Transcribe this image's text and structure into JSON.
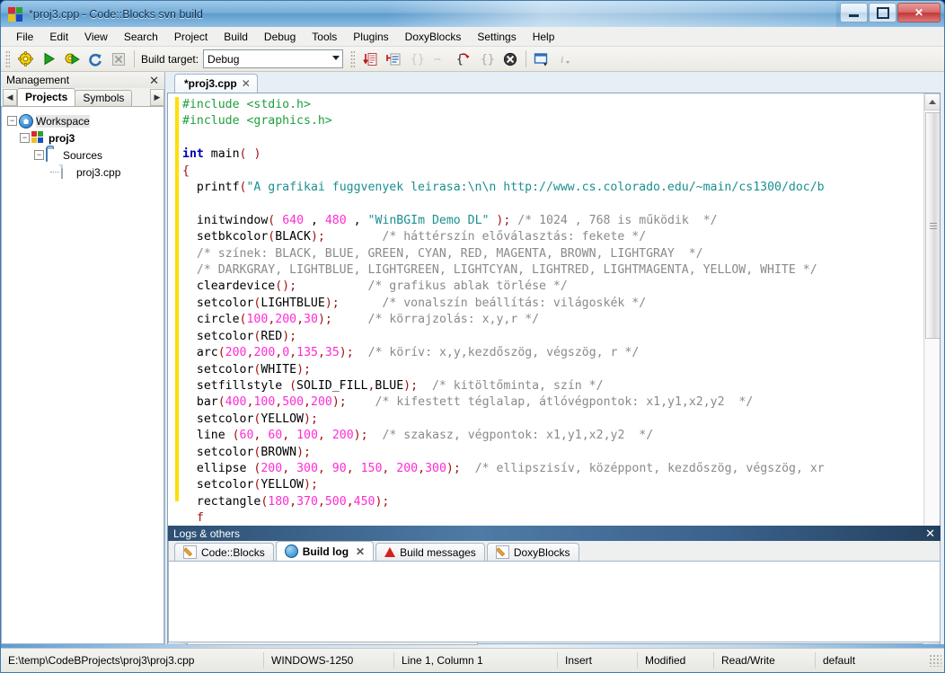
{
  "window": {
    "title": "*proj3.cpp - Code::Blocks svn build",
    "logo_icon": "codeblocks-logo-icon",
    "minimize_label": "minimize-icon",
    "maximize_label": "maximize-icon",
    "close_label": "✕"
  },
  "menubar": {
    "items": [
      {
        "label": "File"
      },
      {
        "label": "Edit"
      },
      {
        "label": "View"
      },
      {
        "label": "Search"
      },
      {
        "label": "Project"
      },
      {
        "label": "Build"
      },
      {
        "label": "Debug"
      },
      {
        "label": "Tools"
      },
      {
        "label": "Plugins"
      },
      {
        "label": "DoxyBlocks"
      },
      {
        "label": "Settings"
      },
      {
        "label": "Help"
      }
    ]
  },
  "toolbar": {
    "build_target_label": "Build target:",
    "build_target_value": "Debug",
    "buttons": [
      {
        "name": "build-icon",
        "glyph": "⚙"
      },
      {
        "name": "run-icon",
        "glyph": "▶"
      },
      {
        "name": "build-and-run-icon",
        "glyph": "⚙▶"
      },
      {
        "name": "rebuild-icon",
        "glyph": "♻"
      },
      {
        "name": "abort-icon",
        "glyph": "✕"
      }
    ],
    "doxy_buttons": [
      {
        "name": "doxyblocks-extract-icon",
        "glyph": "↓"
      },
      {
        "name": "doxyblocks-comment-icon",
        "glyph": "✎"
      },
      {
        "name": "doxyblocks-block-comment-icon",
        "glyph": "{}"
      },
      {
        "name": "doxyblocks-line-comment-icon",
        "glyph": "⋯"
      },
      {
        "name": "doxyblocks-run-icon",
        "glyph": "{↵}"
      },
      {
        "name": "doxyblocks-config-icon",
        "glyph": "{}"
      },
      {
        "name": "doxyblocks-stop-icon",
        "glyph": "✕"
      },
      {
        "name": "doxyblocks-wizard-icon",
        "glyph": "▢"
      },
      {
        "name": "doxyblocks-info-icon",
        "glyph": "i"
      }
    ]
  },
  "management": {
    "title": "Management",
    "close_glyph": "✕",
    "prev_glyph": "◀",
    "next_glyph": "▶",
    "tabs": [
      {
        "label": "Projects",
        "active": true
      },
      {
        "label": "Symbols",
        "active": false
      }
    ],
    "tree": [
      {
        "label": "Workspace",
        "icon": "workspace-icon",
        "depth": 0,
        "expander": "−",
        "bold": false,
        "selected": true
      },
      {
        "label": "proj3",
        "icon": "project-icon",
        "depth": 1,
        "expander": "−",
        "bold": true,
        "selected": false
      },
      {
        "label": "Sources",
        "icon": "folder-icon",
        "depth": 2,
        "expander": "−",
        "bold": false,
        "selected": false
      },
      {
        "label": "proj3.cpp",
        "icon": "file-icon",
        "depth": 3,
        "expander": "",
        "bold": false,
        "selected": false
      }
    ]
  },
  "editor": {
    "tab_label": "*proj3.cpp",
    "tab_close_glyph": "✕",
    "scroll_up_glyph": "▲",
    "scroll_down_glyph": "▼",
    "scroll_left_glyph": "◀",
    "scroll_right_glyph": "▶",
    "code_lines": [
      [
        [
          "#include ",
          "pre"
        ],
        [
          "<stdio.h>",
          "pre"
        ]
      ],
      [
        [
          "#include ",
          "pre"
        ],
        [
          "<graphics.h>",
          "pre"
        ]
      ],
      [],
      [
        [
          "int",
          "kw"
        ],
        [
          " main",
          "id"
        ],
        [
          "(",
          "op"
        ],
        [
          " ",
          "id"
        ],
        [
          ")",
          "op"
        ]
      ],
      [
        [
          "{",
          "op"
        ]
      ],
      [
        [
          "  printf",
          "id"
        ],
        [
          "(",
          "op"
        ],
        [
          "\"A grafikai fuggvenyek leirasa:\\n\\n http://www.cs.colorado.edu/~main/cs1300/doc/b",
          "str"
        ]
      ],
      [],
      [
        [
          "  initwindow",
          "id"
        ],
        [
          "(",
          "op"
        ],
        [
          " ",
          "id"
        ],
        [
          "640",
          "num"
        ],
        [
          " , ",
          "id"
        ],
        [
          "480",
          "num"
        ],
        [
          " , ",
          "id"
        ],
        [
          "\"WinBGIm Demo DL\"",
          "str"
        ],
        [
          " )",
          "op"
        ],
        [
          ";",
          "op"
        ],
        [
          " ",
          "id"
        ],
        [
          "/* 1024 , 768 is működik  */",
          "cmt"
        ]
      ],
      [
        [
          "  setbkcolor",
          "id"
        ],
        [
          "(",
          "op"
        ],
        [
          "BLACK",
          "id"
        ],
        [
          ")",
          "op"
        ],
        [
          ";",
          "op"
        ],
        [
          "        ",
          "id"
        ],
        [
          "/* háttérszín előválasztás: fekete */",
          "cmt"
        ]
      ],
      [
        [
          "  ",
          "id"
        ],
        [
          "/* színek: BLACK, BLUE, GREEN, CYAN, RED, MAGENTA, BROWN, LIGHTGRAY  */",
          "cmt"
        ]
      ],
      [
        [
          "  ",
          "id"
        ],
        [
          "/* DARKGRAY, LIGHTBLUE, LIGHTGREEN, LIGHTCYAN, LIGHTRED, LIGHTMAGENTA, YELLOW, WHITE */",
          "cmt"
        ]
      ],
      [
        [
          "  cleardevice",
          "id"
        ],
        [
          "(",
          "op"
        ],
        [
          ")",
          "op"
        ],
        [
          ";",
          "op"
        ],
        [
          "          ",
          "id"
        ],
        [
          "/* grafikus ablak törlése */",
          "cmt"
        ]
      ],
      [
        [
          "  setcolor",
          "id"
        ],
        [
          "(",
          "op"
        ],
        [
          "LIGHTBLUE",
          "id"
        ],
        [
          ")",
          "op"
        ],
        [
          ";",
          "op"
        ],
        [
          "      ",
          "id"
        ],
        [
          "/* vonalszín beállítás: világoskék */",
          "cmt"
        ]
      ],
      [
        [
          "  circle",
          "id"
        ],
        [
          "(",
          "op"
        ],
        [
          "100",
          "num"
        ],
        [
          ",",
          "op"
        ],
        [
          "200",
          "num"
        ],
        [
          ",",
          "op"
        ],
        [
          "30",
          "num"
        ],
        [
          ")",
          "op"
        ],
        [
          ";",
          "op"
        ],
        [
          "     ",
          "id"
        ],
        [
          "/* körrajzolás: x,y,r */",
          "cmt"
        ]
      ],
      [
        [
          "  setcolor",
          "id"
        ],
        [
          "(",
          "op"
        ],
        [
          "RED",
          "id"
        ],
        [
          ")",
          "op"
        ],
        [
          ";",
          "op"
        ]
      ],
      [
        [
          "  arc",
          "id"
        ],
        [
          "(",
          "op"
        ],
        [
          "200",
          "num"
        ],
        [
          ",",
          "op"
        ],
        [
          "200",
          "num"
        ],
        [
          ",",
          "op"
        ],
        [
          "0",
          "num"
        ],
        [
          ",",
          "op"
        ],
        [
          "135",
          "num"
        ],
        [
          ",",
          "op"
        ],
        [
          "35",
          "num"
        ],
        [
          ")",
          "op"
        ],
        [
          ";",
          "op"
        ],
        [
          "  ",
          "id"
        ],
        [
          "/* körív: x,y,kezdőszög, végszög, r */",
          "cmt"
        ]
      ],
      [
        [
          "  setcolor",
          "id"
        ],
        [
          "(",
          "op"
        ],
        [
          "WHITE",
          "id"
        ],
        [
          ")",
          "op"
        ],
        [
          ";",
          "op"
        ]
      ],
      [
        [
          "  setfillstyle ",
          "id"
        ],
        [
          "(",
          "op"
        ],
        [
          "SOLID_FILL",
          "id"
        ],
        [
          ",",
          "op"
        ],
        [
          "BLUE",
          "id"
        ],
        [
          ")",
          "op"
        ],
        [
          ";",
          "op"
        ],
        [
          "  ",
          "id"
        ],
        [
          "/* kitöltőminta, szín */",
          "cmt"
        ]
      ],
      [
        [
          "  bar",
          "id"
        ],
        [
          "(",
          "op"
        ],
        [
          "400",
          "num"
        ],
        [
          ",",
          "op"
        ],
        [
          "100",
          "num"
        ],
        [
          ",",
          "op"
        ],
        [
          "500",
          "num"
        ],
        [
          ",",
          "op"
        ],
        [
          "200",
          "num"
        ],
        [
          ")",
          "op"
        ],
        [
          ";",
          "op"
        ],
        [
          "    ",
          "id"
        ],
        [
          "/* kifestett téglalap, átlóvégpontok: x1,y1,x2,y2  */",
          "cmt"
        ]
      ],
      [
        [
          "  setcolor",
          "id"
        ],
        [
          "(",
          "op"
        ],
        [
          "YELLOW",
          "id"
        ],
        [
          ")",
          "op"
        ],
        [
          ";",
          "op"
        ]
      ],
      [
        [
          "  line ",
          "id"
        ],
        [
          "(",
          "op"
        ],
        [
          "60",
          "num"
        ],
        [
          ", ",
          "op"
        ],
        [
          "60",
          "num"
        ],
        [
          ", ",
          "op"
        ],
        [
          "100",
          "num"
        ],
        [
          ", ",
          "op"
        ],
        [
          "200",
          "num"
        ],
        [
          ")",
          "op"
        ],
        [
          ";",
          "op"
        ],
        [
          "  ",
          "id"
        ],
        [
          "/* szakasz, végpontok: x1,y1,x2,y2  */",
          "cmt"
        ]
      ],
      [
        [
          "  setcolor",
          "id"
        ],
        [
          "(",
          "op"
        ],
        [
          "BROWN",
          "id"
        ],
        [
          ")",
          "op"
        ],
        [
          ";",
          "op"
        ]
      ],
      [
        [
          "  ellipse ",
          "id"
        ],
        [
          "(",
          "op"
        ],
        [
          "200",
          "num"
        ],
        [
          ", ",
          "op"
        ],
        [
          "300",
          "num"
        ],
        [
          ", ",
          "op"
        ],
        [
          "90",
          "num"
        ],
        [
          ", ",
          "op"
        ],
        [
          "150",
          "num"
        ],
        [
          ", ",
          "op"
        ],
        [
          "200",
          "num"
        ],
        [
          ",",
          "op"
        ],
        [
          "300",
          "num"
        ],
        [
          ")",
          "op"
        ],
        [
          ";",
          "op"
        ],
        [
          "  ",
          "id"
        ],
        [
          "/* ellipszisív, középpont, kezdőszög, végszög, xr",
          "cmt"
        ]
      ],
      [
        [
          "  setcolor",
          "id"
        ],
        [
          "(",
          "op"
        ],
        [
          "YELLOW",
          "id"
        ],
        [
          ")",
          "op"
        ],
        [
          ";",
          "op"
        ]
      ],
      [
        [
          "  rectangle",
          "id"
        ],
        [
          "(",
          "op"
        ],
        [
          "180",
          "num"
        ],
        [
          ",",
          "op"
        ],
        [
          "370",
          "num"
        ],
        [
          ",",
          "op"
        ],
        [
          "500",
          "num"
        ],
        [
          ",",
          "op"
        ],
        [
          "450",
          "num"
        ],
        [
          ")",
          "op"
        ],
        [
          ";",
          "op"
        ]
      ],
      [
        [
          "  f",
          "op"
        ]
      ]
    ]
  },
  "logs": {
    "title": "Logs & others",
    "close_glyph": "✕",
    "tabs": [
      {
        "label": "Code::Blocks",
        "icon": "pencil-icon",
        "active": false,
        "closable": false
      },
      {
        "label": "Build log",
        "icon": "gear-icon",
        "active": true,
        "closable": true
      },
      {
        "label": "Build messages",
        "icon": "warning-icon",
        "active": false,
        "closable": false
      },
      {
        "label": "DoxyBlocks",
        "icon": "pencil-icon",
        "active": false,
        "closable": false
      }
    ],
    "tab_close_glyph": "✕",
    "content": ""
  },
  "statusbar": {
    "file_path": "E:\\temp\\CodeBProjects\\proj3\\proj3.cpp",
    "encoding": "WINDOWS-1250",
    "caret": "Line 1, Column 1",
    "insert_mode": "Insert",
    "modified": "Modified",
    "access": "Read/Write",
    "profile": "default"
  },
  "colors": {
    "accent": "#3f7cb0",
    "titlebar_text": "#11304f",
    "logs_header": "#2c4f73",
    "change_bar": "#ffe000",
    "syntax_preprocessor": "#1f9f3f",
    "syntax_keyword": "#0000b0",
    "syntax_string": "#1c8f8f",
    "syntax_number": "#ff2ad4",
    "syntax_comment": "#8a8a8a",
    "syntax_operator": "#a01010"
  }
}
